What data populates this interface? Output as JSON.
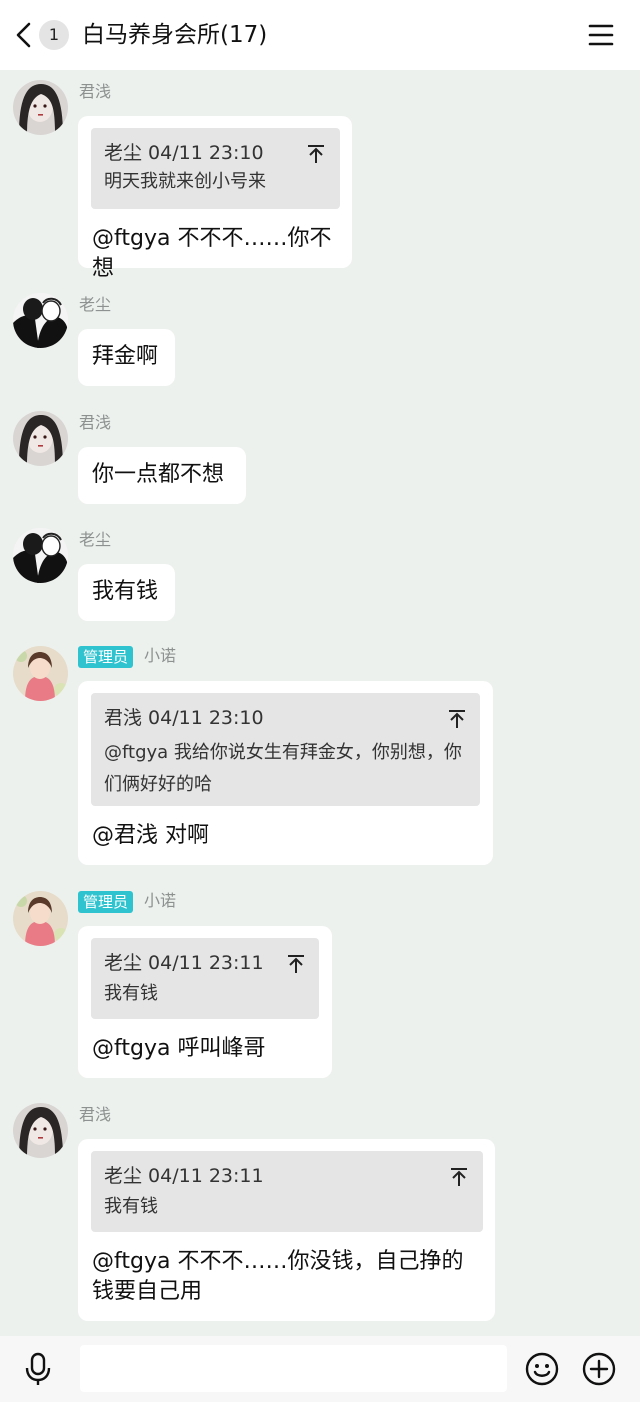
{
  "header": {
    "back_badge": "1",
    "title": "白马养身会所(17)"
  },
  "messages": [
    {
      "sender": "君浅",
      "quote": {
        "header": "老尘 04/11 23:10",
        "text": "明天我就来创小号来"
      },
      "text": "@ftgya 不不不……你不想"
    },
    {
      "sender": "老尘",
      "text": "拜金啊"
    },
    {
      "sender": "君浅",
      "text": "你一点都不想"
    },
    {
      "sender": "老尘",
      "text": "我有钱"
    },
    {
      "sender": "小诺",
      "tag": "管理员",
      "quote": {
        "header": "君浅 04/11 23:10",
        "text": "@ftgya 我给你说女生有拜金女，你别想，你们俩好好的哈"
      },
      "text": "@君浅 对啊"
    },
    {
      "sender": "小诺",
      "tag": "管理员",
      "quote": {
        "header": "老尘 04/11 23:11",
        "text": "我有钱"
      },
      "text": "@ftgya 呼叫峰哥"
    },
    {
      "sender": "君浅",
      "quote": {
        "header": "老尘 04/11 23:11",
        "text": "我有钱"
      },
      "text": "@ftgya 不不不……你没钱，自己挣的钱要自己用"
    }
  ],
  "icons": {
    "back": "chevron-left-icon",
    "menu": "hamburger-menu-icon",
    "pin": "pin-to-top-icon",
    "mic": "microphone-icon",
    "emoji": "smiley-face-icon",
    "plus": "plus-circle-icon"
  },
  "colors": {
    "background": "#edf1ee",
    "bubble": "#ffffff",
    "quote_bg": "#e5e5e5",
    "admin_tag": "#2fc3cf",
    "nickname": "#8d9290"
  }
}
